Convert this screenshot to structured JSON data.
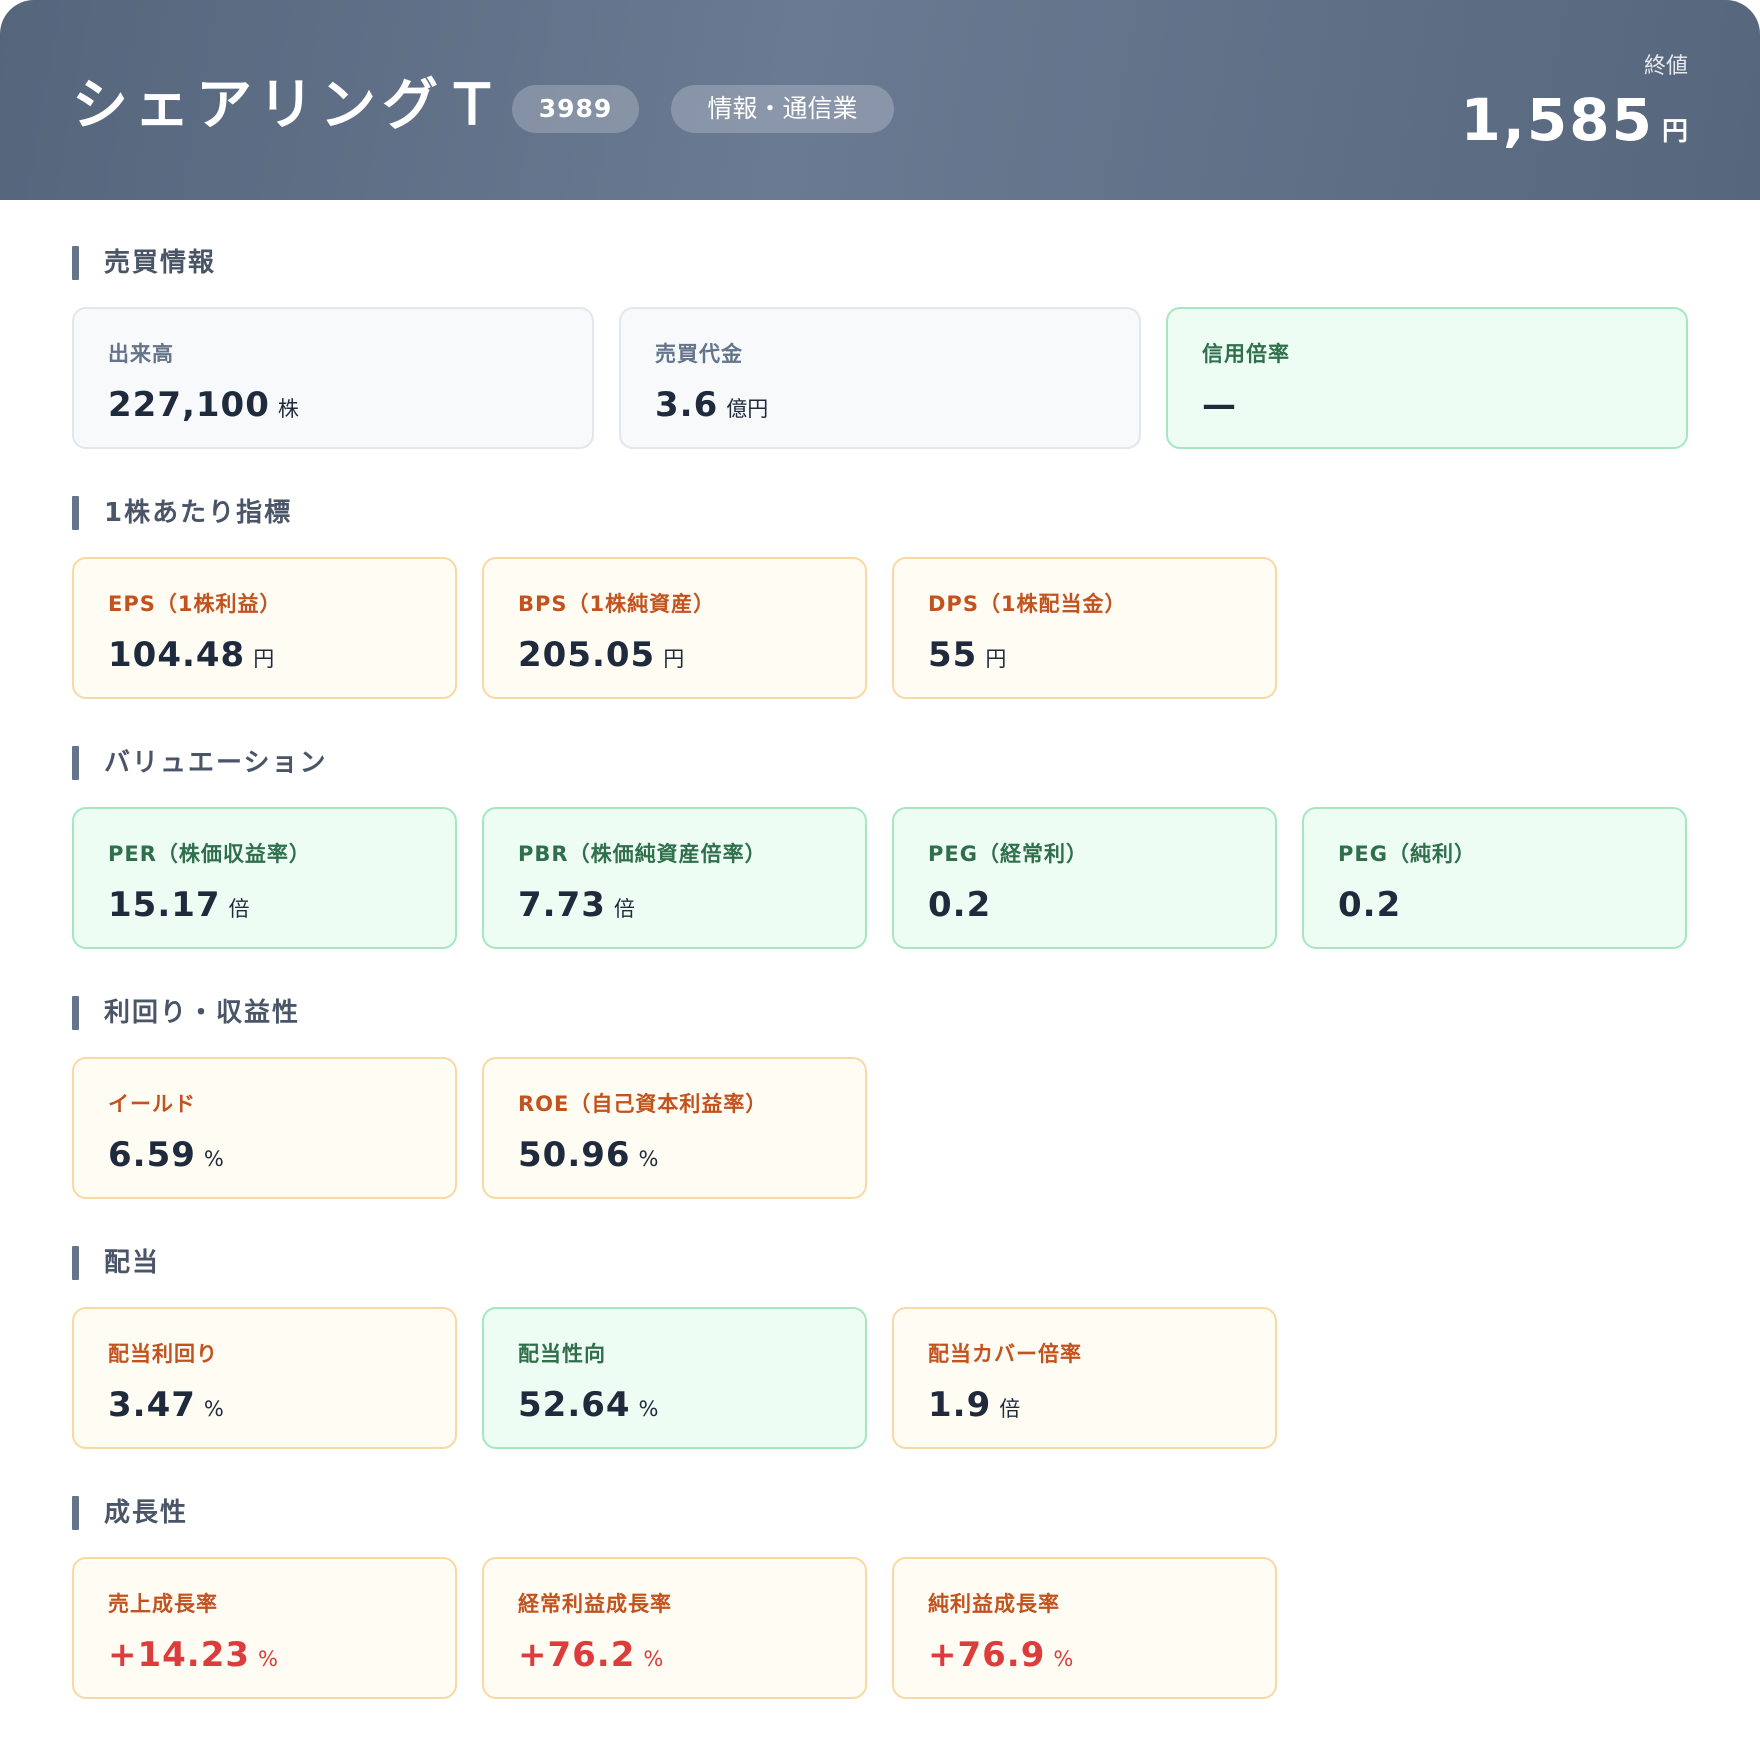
{
  "header": {
    "company_name": "シェアリングＴ",
    "code": "3989",
    "sector": "情報・通信業",
    "price_label": "終値",
    "price_value": "1,585",
    "price_unit": "円"
  },
  "sections": {
    "trading": {
      "title": "売買情報",
      "volume": {
        "label": "出来高",
        "value": "227,100",
        "unit": "株"
      },
      "turnover": {
        "label": "売買代金",
        "value": "3.6",
        "unit": "億円"
      },
      "margin_ratio": {
        "label": "信用倍率",
        "value": "—",
        "unit": ""
      }
    },
    "per_share": {
      "title": "1株あたり指標",
      "eps": {
        "label": "EPS（1株利益）",
        "value": "104.48",
        "unit": "円"
      },
      "bps": {
        "label": "BPS（1株純資産）",
        "value": "205.05",
        "unit": "円"
      },
      "dps": {
        "label": "DPS（1株配当金）",
        "value": "55",
        "unit": "円"
      }
    },
    "valuation": {
      "title": "バリュエーション",
      "per": {
        "label": "PER（株価収益率）",
        "value": "15.17",
        "unit": "倍"
      },
      "pbr": {
        "label": "PBR（株価純資産倍率）",
        "value": "7.73",
        "unit": "倍"
      },
      "peg_ordinary": {
        "label": "PEG（経常利）",
        "value": "0.2",
        "unit": ""
      },
      "peg_net": {
        "label": "PEG（純利）",
        "value": "0.2",
        "unit": ""
      }
    },
    "yield": {
      "title": "利回り・収益性",
      "earnings_yield": {
        "label": "イールド",
        "value": "6.59",
        "unit": "%"
      },
      "roe": {
        "label": "ROE（自己資本利益率）",
        "value": "50.96",
        "unit": "%"
      }
    },
    "dividend": {
      "title": "配当",
      "dividend_yield": {
        "label": "配当利回り",
        "value": "3.47",
        "unit": "%"
      },
      "payout_ratio": {
        "label": "配当性向",
        "value": "52.64",
        "unit": "%"
      },
      "dividend_cover": {
        "label": "配当カバー倍率",
        "value": "1.9",
        "unit": "倍"
      }
    },
    "growth": {
      "title": "成長性",
      "sales_growth": {
        "label": "売上成長率",
        "value": "+14.23",
        "unit": "%"
      },
      "ordinary_profit_growth": {
        "label": "経常利益成長率",
        "value": "+76.2",
        "unit": "%"
      },
      "net_profit_growth": {
        "label": "純利益成長率",
        "value": "+76.9",
        "unit": "%"
      }
    }
  },
  "colors": {
    "header_bg": "#5f6f86",
    "neutral_card_bg": "#f7f9fb",
    "green_card_bg": "#edfdf3",
    "green_card_border": "#a6e7c0",
    "orange_card_bg": "#fffcf4",
    "orange_card_border": "#f8d9a4",
    "positive_value": "#dc3c3c"
  }
}
